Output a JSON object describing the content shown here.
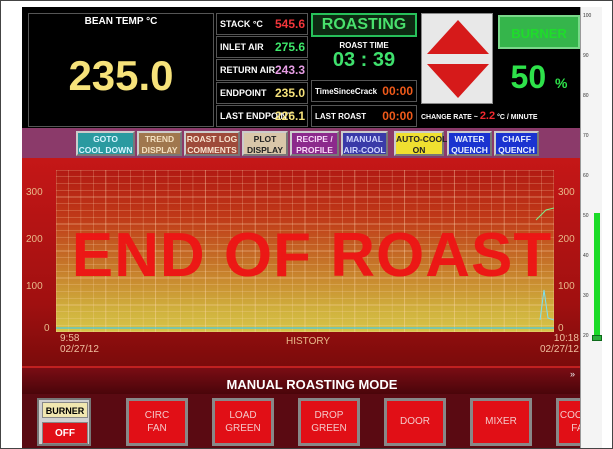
{
  "bean_temp": {
    "title": "BEAN TEMP °C",
    "value": "235.0"
  },
  "readings": [
    {
      "label": "STACK °C",
      "value": "545.6",
      "color": "#f3363b"
    },
    {
      "label": "INLET AIR",
      "value": "275.6",
      "color": "#3ee86b"
    },
    {
      "label": "RETURN AIR",
      "value": "243.3",
      "color": "#e89ee6"
    },
    {
      "label": "ENDPOINT",
      "value": "235.0",
      "color": "#f6e27a"
    },
    {
      "label": "LAST ENDPOINT",
      "value": "226.1",
      "color": "#f6e27a"
    }
  ],
  "status": {
    "label": "ROASTING",
    "roast_time_title": "ROAST TIME",
    "roast_time": "03 : 39"
  },
  "since_crack": {
    "label": "TimeSinceCrack",
    "value": "00:00"
  },
  "last_roast": {
    "label": "LAST ROAST",
    "value": "00:00"
  },
  "burner": {
    "label": "BURNER",
    "value": "50",
    "unit": "%"
  },
  "change_rate": {
    "label": "CHANGE RATE ~",
    "value": "2.2",
    "unit": "°C / MINUTE"
  },
  "toolbar": [
    {
      "id": "goto",
      "label1": "GOTO",
      "label2": "COOL DOWN",
      "bg": "#2a9aa0",
      "fg": "#d7f4ff"
    },
    {
      "id": "trend",
      "label1": "TREND",
      "label2": "DISPLAY",
      "bg": "#a0774e",
      "fg": "#f3e0c0"
    },
    {
      "id": "roastlog",
      "label1": "ROAST LOG",
      "label2": "COMMENTS",
      "bg": "#9e4a3a",
      "fg": "#f8e4d0"
    },
    {
      "id": "plot",
      "label1": "PLOT",
      "label2": "DISPLAY",
      "bg": "#d9c7a9",
      "fg": "#222"
    },
    {
      "id": "recipe",
      "label1": "RECIPE /",
      "label2": "PROFILE",
      "bg": "#8c2a8c",
      "fg": "#f7d8f7"
    },
    {
      "id": "manual",
      "label1": "MANUAL",
      "label2": "AIR-COOL",
      "bg": "#3a3aa8",
      "fg": "#d0d7ff"
    },
    {
      "id": "autocool",
      "label1": "AUTO-COOL",
      "label2": "ON",
      "bg": "#f0e030",
      "fg": "#222"
    },
    {
      "id": "water",
      "label1": "WATER",
      "label2": "QUENCH",
      "bg": "#1a33d0",
      "fg": "#e8f0ff"
    },
    {
      "id": "chaff",
      "label1": "CHAFF",
      "label2": "QUENCH",
      "bg": "#1a33d0",
      "fg": "#e8f0ff"
    }
  ],
  "graph": {
    "y_ticks": [
      "300",
      "200",
      "100",
      "0"
    ],
    "x_start": {
      "time": "9:58",
      "date": "02/27/12"
    },
    "x_end": {
      "time": "10:18",
      "date": "02/27/12"
    },
    "history_label": "HISTORY",
    "overlay_text": "END OF ROAST"
  },
  "mode_label": "MANUAL ROASTING MODE",
  "mode_chevron": "»",
  "bottom_buttons": [
    {
      "id": "circ",
      "label1": "CIRC",
      "label2": "FAN"
    },
    {
      "id": "load",
      "label1": "LOAD",
      "label2": "GREEN"
    },
    {
      "id": "drop",
      "label1": "DROP",
      "label2": "GREEN"
    },
    {
      "id": "door",
      "label1": "DOOR",
      "label2": ""
    },
    {
      "id": "mixer",
      "label1": "MIXER",
      "label2": ""
    },
    {
      "id": "cooler",
      "label1": "COOLER",
      "label2": "FAN"
    }
  ],
  "burner_button": {
    "label": "BURNER",
    "state": "OFF"
  },
  "gauge": {
    "ticks": [
      "100",
      "90",
      "80",
      "70",
      "60",
      "50",
      "40",
      "30",
      "20"
    ],
    "level_percent": 50
  }
}
